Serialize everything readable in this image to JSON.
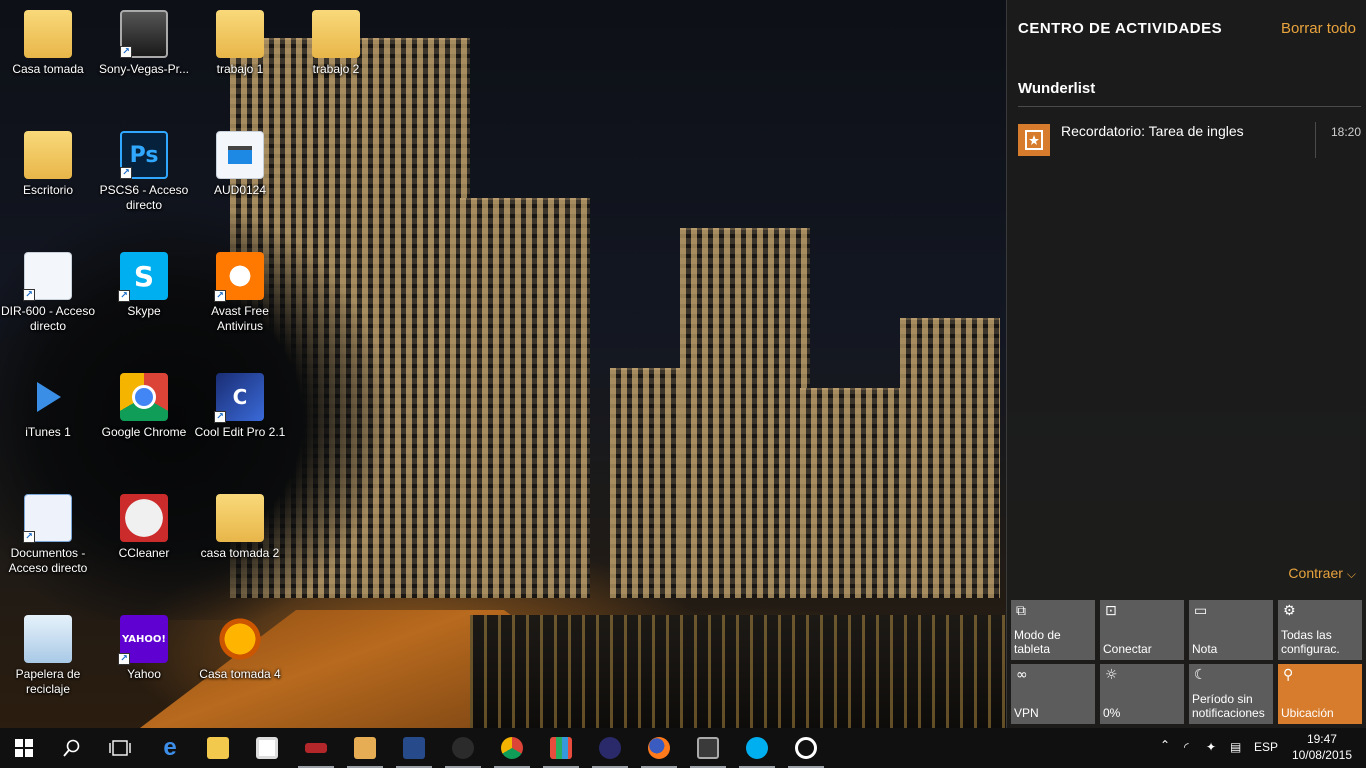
{
  "desktop": {
    "icons": [
      {
        "label": "Casa tomada",
        "glyph": "folder-doc-icon"
      },
      {
        "label": "Sony-Vegas-Pr...",
        "glyph": "sony-vegas-icon"
      },
      {
        "label": "trabajo 1",
        "glyph": "folder-icon"
      },
      {
        "label": "trabajo 2",
        "glyph": "folder-icon"
      },
      {
        "label": "Escritorio",
        "glyph": "folder-firefox-icon"
      },
      {
        "label": "PSCS6 - Acceso directo",
        "glyph": "photoshop-icon",
        "text": "Ps"
      },
      {
        "label": "AUD0124",
        "glyph": "video-file-icon"
      },
      {
        "label": "DIR-600 - Acceso directo",
        "glyph": "blank-file-icon"
      },
      {
        "label": "Skype",
        "glyph": "skype-icon",
        "text": "S"
      },
      {
        "label": "Avast Free Antivirus",
        "glyph": "avast-icon"
      },
      {
        "label": "iTunes 1",
        "glyph": "play-arrow-icon"
      },
      {
        "label": "Google Chrome",
        "glyph": "chrome-icon"
      },
      {
        "label": "Cool Edit Pro 2.1",
        "glyph": "cool-edit-icon"
      },
      {
        "label": "Documentos - Acceso directo",
        "glyph": "documents-icon"
      },
      {
        "label": "CCleaner",
        "glyph": "ccleaner-icon"
      },
      {
        "label": "casa tomada 2",
        "glyph": "folder-doc-icon"
      },
      {
        "label": "Papelera de reciclaje",
        "glyph": "recycle-bin-icon"
      },
      {
        "label": "Yahoo",
        "glyph": "yahoo-icon",
        "text": "YAHOO!"
      },
      {
        "label": "Casa tomada 4",
        "glyph": "audacity-icon"
      }
    ]
  },
  "action_center": {
    "title": "CENTRO DE ACTIVIDADES",
    "clear_all": "Borrar todo",
    "app_name": "Wunderlist",
    "notification": {
      "text": "Recordatorio: Tarea de ingles",
      "time": "18:20"
    },
    "collapse": "Contraer",
    "tiles": [
      {
        "label": "Modo de tableta",
        "icon": "tablet-mode-icon",
        "active": false
      },
      {
        "label": "Conectar",
        "icon": "connect-icon",
        "active": false
      },
      {
        "label": "Nota",
        "icon": "note-icon",
        "active": false
      },
      {
        "label": "Todas las configurac.",
        "icon": "settings-icon",
        "active": false
      },
      {
        "label": "VPN",
        "icon": "vpn-icon",
        "active": false
      },
      {
        "label": "0%",
        "icon": "brightness-icon",
        "active": false
      },
      {
        "label": "Período sin notificaciones",
        "icon": "moon-icon",
        "active": false
      },
      {
        "label": "Ubicación",
        "icon": "location-icon",
        "active": true
      }
    ],
    "colors": {
      "accent": "#d77c2d",
      "tile": "#5c5c5c"
    }
  },
  "taskbar": {
    "buttons": [
      "start-icon",
      "search-icon",
      "task-view-icon",
      "edge-icon",
      "file-explorer-icon",
      "store-icon",
      "app-red-icon",
      "video-player-icon",
      "movie-app-icon",
      "gamepad-app-icon",
      "chrome-icon",
      "apps-grid-icon",
      "wizard-app-icon",
      "firefox-icon",
      "media-icon",
      "skype-icon",
      "groove-icon"
    ],
    "language": "ESP",
    "time": "19:47",
    "date": "10/08/2015"
  }
}
